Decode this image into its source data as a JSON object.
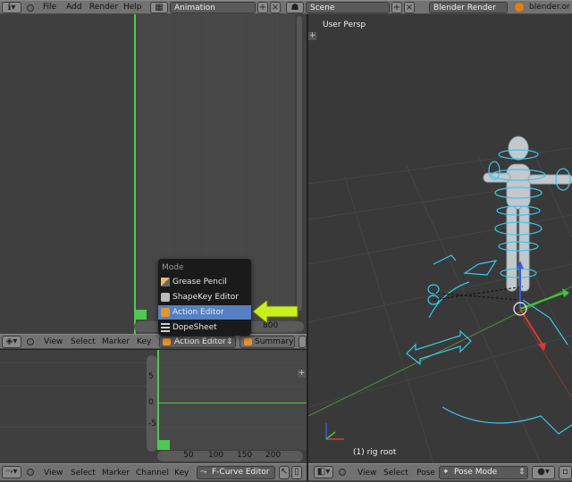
{
  "top_bar": {
    "menus": [
      "File",
      "Add",
      "Render",
      "Help"
    ],
    "screen_layout": "Animation",
    "scene": "Scene",
    "render_engine": "Blender Render",
    "url": "blender.or"
  },
  "dopesheet_editor": {
    "ruler_value": "800",
    "header": {
      "menus": [
        "View",
        "Select",
        "Marker",
        "Key"
      ],
      "mode": "Action Editor",
      "summary": "Summary"
    }
  },
  "mode_menu": {
    "title": "Mode",
    "items": [
      "Grease Pencil",
      "ShapeKey Editor",
      "Action Editor",
      "DopeSheet"
    ],
    "selected": "Action Editor"
  },
  "graph_editor": {
    "y_ticks": [
      "5",
      "0",
      "-5"
    ],
    "x_ticks": [
      "50",
      "100",
      "150",
      "200"
    ],
    "header": {
      "menus": [
        "View",
        "Select",
        "Marker",
        "Channel",
        "Key"
      ],
      "mode": "F-Curve Editor"
    }
  },
  "viewport": {
    "label": "User Persp",
    "object_label": "(1) rig root",
    "header": {
      "menus": [
        "View",
        "Select",
        "Pose"
      ],
      "mode": "Pose Mode"
    }
  },
  "colors": {
    "accent_green": "#4fc84f",
    "selected_blue": "#5680c2",
    "arrow": "#c8f020",
    "rig_cyan": "#39c8f0"
  }
}
